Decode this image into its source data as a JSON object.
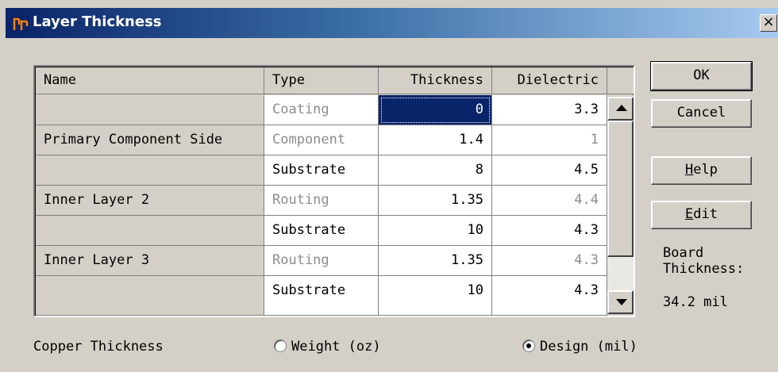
{
  "window": {
    "title": "Layer Thickness",
    "close_glyph": "×"
  },
  "grid": {
    "headers": [
      "Name",
      "Type",
      "Thickness",
      "Dielectric"
    ],
    "rows": [
      {
        "name": "",
        "type": "Coating",
        "thickness": "0",
        "dielectric": "3.3"
      },
      {
        "name": "Primary Component Side",
        "type": "Component",
        "thickness": "1.4",
        "dielectric": "1"
      },
      {
        "name": "",
        "type": "Substrate",
        "thickness": "8",
        "dielectric": "4.5"
      },
      {
        "name": "Inner Layer 2",
        "type": "Routing",
        "thickness": "1.35",
        "dielectric": "4.4"
      },
      {
        "name": "",
        "type": "Substrate",
        "thickness": "10",
        "dielectric": "4.3"
      },
      {
        "name": "Inner Layer 3",
        "type": "Routing",
        "thickness": "1.35",
        "dielectric": "4.3"
      },
      {
        "name": "",
        "type": "Substrate",
        "thickness": "10",
        "dielectric": "4.3"
      }
    ]
  },
  "buttons": {
    "ok": "OK",
    "cancel": "Cancel",
    "help_mnemonic": "H",
    "help_rest": "elp",
    "edit_mnemonic": "E",
    "edit_rest": "dit"
  },
  "board": {
    "label": "Board Thickness:",
    "value": "34.2 mil"
  },
  "copper": {
    "label": "Copper Thickness",
    "weight_label": "Weight (oz)",
    "design_label": "Design (mil)",
    "selected": "design"
  },
  "colors": {
    "titlebar_start": "#0a246a",
    "titlebar_end": "#a6caf0",
    "selection": "#0a246a",
    "face": "#d4d0c8"
  },
  "icons": [
    "app-icon",
    "close-icon",
    "scroll-up-arrow-icon",
    "scroll-down-arrow-icon"
  ]
}
